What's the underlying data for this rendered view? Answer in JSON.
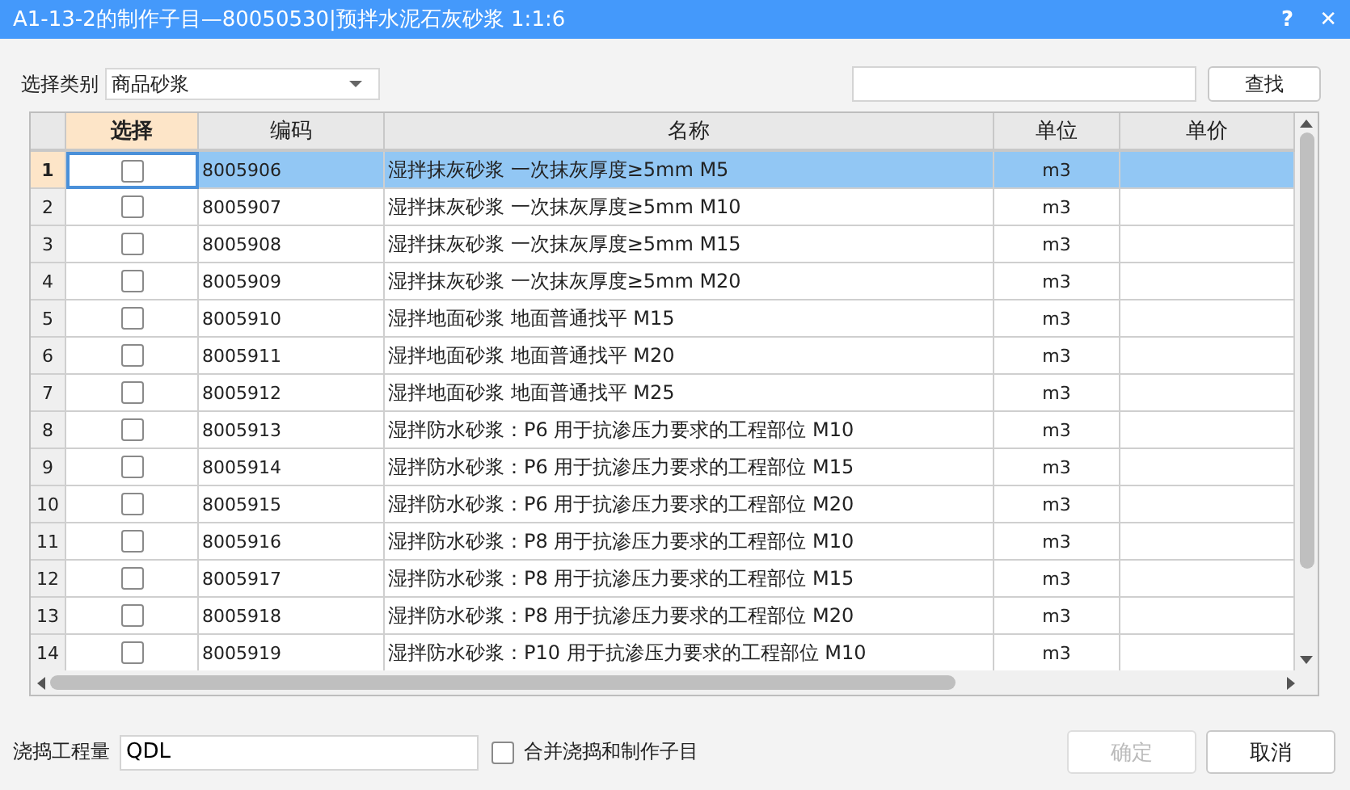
{
  "window": {
    "title": "A1-13-2的制作子目—80050530|预拌水泥石灰砂浆 1:1:6",
    "help": "?",
    "close": "✕"
  },
  "category": {
    "label": "选择类别",
    "value": "商品砂浆"
  },
  "search": {
    "button": "查找"
  },
  "table": {
    "columns": [
      {
        "label": "选择",
        "selected": true
      },
      {
        "label": "编码",
        "selected": false
      },
      {
        "label": "名称",
        "selected": false
      },
      {
        "label": "单位",
        "selected": false
      },
      {
        "label": "单价",
        "selected": false
      }
    ],
    "rows": [
      {
        "index": "1",
        "code": "8005906",
        "name": "湿拌抹灰砂浆 一次抹灰厚度≥5mm M5",
        "unit": "m3",
        "checked": false,
        "selected": true
      },
      {
        "index": "2",
        "code": "8005907",
        "name": "湿拌抹灰砂浆 一次抹灰厚度≥5mm M10",
        "unit": "m3",
        "checked": false,
        "selected": false
      },
      {
        "index": "3",
        "code": "8005908",
        "name": "湿拌抹灰砂浆 一次抹灰厚度≥5mm M15",
        "unit": "m3",
        "checked": false,
        "selected": false
      },
      {
        "index": "4",
        "code": "8005909",
        "name": "湿拌抹灰砂浆 一次抹灰厚度≥5mm M20",
        "unit": "m3",
        "checked": false,
        "selected": false
      },
      {
        "index": "5",
        "code": "8005910",
        "name": "湿拌地面砂浆 地面普通找平 M15",
        "unit": "m3",
        "checked": false,
        "selected": false
      },
      {
        "index": "6",
        "code": "8005911",
        "name": "湿拌地面砂浆 地面普通找平 M20",
        "unit": "m3",
        "checked": false,
        "selected": false
      },
      {
        "index": "7",
        "code": "8005912",
        "name": "湿拌地面砂浆 地面普通找平 M25",
        "unit": "m3",
        "checked": false,
        "selected": false
      },
      {
        "index": "8",
        "code": "8005913",
        "name": "湿拌防水砂浆：P6 用于抗渗压力要求的工程部位 M10",
        "unit": "m3",
        "checked": false,
        "selected": false
      },
      {
        "index": "9",
        "code": "8005914",
        "name": "湿拌防水砂浆：P6 用于抗渗压力要求的工程部位 M15",
        "unit": "m3",
        "checked": false,
        "selected": false
      },
      {
        "index": "10",
        "code": "8005915",
        "name": "湿拌防水砂浆：P6 用于抗渗压力要求的工程部位 M20",
        "unit": "m3",
        "checked": false,
        "selected": false
      },
      {
        "index": "11",
        "code": "8005916",
        "name": "湿拌防水砂浆：P8 用于抗渗压力要求的工程部位 M10",
        "unit": "m3",
        "checked": false,
        "selected": false
      },
      {
        "index": "12",
        "code": "8005917",
        "name": "湿拌防水砂浆：P8 用于抗渗压力要求的工程部位 M15",
        "unit": "m3",
        "checked": false,
        "selected": false
      },
      {
        "index": "13",
        "code": "8005918",
        "name": "湿拌防水砂浆：P8 用于抗渗压力要求的工程部位 M20",
        "unit": "m3",
        "checked": false,
        "selected": false
      },
      {
        "index": "14",
        "code": "8005919",
        "name": "湿拌防水砂浆：P10 用于抗渗压力要求的工程部位 M10",
        "unit": "m3",
        "checked": false,
        "selected": false
      }
    ]
  },
  "quantity": {
    "label": "浇捣工程量",
    "value": "QDL"
  },
  "merge": {
    "label": "合并浇捣和制作子目",
    "checked": false
  },
  "buttons": [
    {
      "label": "确定",
      "disabled": true
    },
    {
      "label": "取消",
      "disabled": false
    }
  ]
}
